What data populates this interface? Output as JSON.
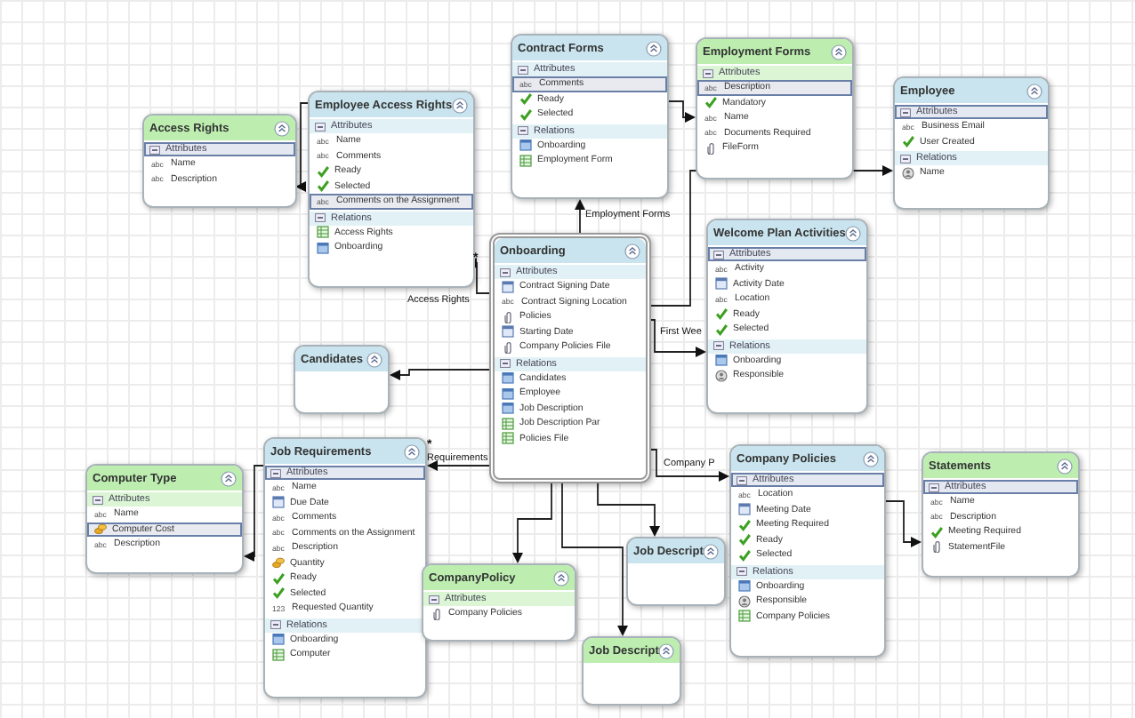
{
  "entities": [
    {
      "title": "Access Rights",
      "color": "#bdeeb0",
      "selected": false,
      "sections": [
        {
          "label": "Attributes",
          "selected": true,
          "items": [
            {
              "kind": "text",
              "type_label": "abc",
              "label": "Name",
              "selected": false
            },
            {
              "kind": "text",
              "type_label": "abc",
              "label": "Description",
              "selected": false
            }
          ]
        }
      ]
    },
    {
      "title": "Employee Access Rights",
      "color": "#c9e4ee",
      "selected": false,
      "sections": [
        {
          "label": "Attributes",
          "selected": false,
          "items": [
            {
              "kind": "text",
              "type_label": "abc",
              "label": "Name",
              "selected": false
            },
            {
              "kind": "text",
              "type_label": "abc",
              "label": "Comments",
              "selected": false
            },
            {
              "kind": "check",
              "label": "Ready",
              "selected": false
            },
            {
              "kind": "check",
              "label": "Selected",
              "selected": false
            },
            {
              "kind": "text",
              "type_label": "abc",
              "label": "Comments on the Assignment",
              "selected": true
            }
          ]
        },
        {
          "label": "Relations",
          "selected": false,
          "items": [
            {
              "kind": "table",
              "label": "Access Rights",
              "selected": false
            },
            {
              "kind": "entity",
              "label": "Onboarding",
              "selected": false
            }
          ]
        }
      ]
    },
    {
      "title": "Contract Forms",
      "color": "#c9e4ee",
      "selected": false,
      "sections": [
        {
          "label": "Attributes",
          "selected": false,
          "items": [
            {
              "kind": "text",
              "type_label": "abc",
              "label": "Comments",
              "selected": true
            },
            {
              "kind": "check",
              "label": "Ready",
              "selected": false
            },
            {
              "kind": "check",
              "label": "Selected",
              "selected": false
            }
          ]
        },
        {
          "label": "Relations",
          "selected": false,
          "items": [
            {
              "kind": "entity",
              "label": "Onboarding",
              "selected": false
            },
            {
              "kind": "table",
              "label": "Employment Form",
              "selected": false
            }
          ]
        }
      ]
    },
    {
      "title": "Employment Forms",
      "color": "#bdeeb0",
      "selected": false,
      "sections": [
        {
          "label": "Attributes",
          "selected": false,
          "items": [
            {
              "kind": "text",
              "type_label": "abc",
              "label": "Description",
              "selected": true
            },
            {
              "kind": "check",
              "label": "Mandatory",
              "selected": false
            },
            {
              "kind": "text",
              "type_label": "abc",
              "label": "Name",
              "selected": false
            },
            {
              "kind": "text",
              "type_label": "abc",
              "label": "Documents Required",
              "selected": false
            },
            {
              "kind": "attachment",
              "label": "FileForm",
              "selected": false
            }
          ]
        }
      ]
    },
    {
      "title": "Employee",
      "color": "#c9e4ee",
      "selected": false,
      "sections": [
        {
          "label": "Attributes",
          "selected": true,
          "items": [
            {
              "kind": "text",
              "type_label": "abc",
              "label": "Business Email",
              "selected": false
            },
            {
              "kind": "check",
              "label": "User Created",
              "selected": false
            }
          ]
        },
        {
          "label": "Relations",
          "selected": false,
          "items": [
            {
              "kind": "user",
              "label": "Name",
              "selected": false
            }
          ]
        }
      ]
    },
    {
      "title": "Onboarding",
      "color": "#c9e4ee",
      "selected": true,
      "sections": [
        {
          "label": "Attributes",
          "selected": false,
          "items": [
            {
              "kind": "date",
              "label": "Contract Signing Date",
              "selected": false
            },
            {
              "kind": "text",
              "type_label": "abc",
              "label": "Contract Signing Location",
              "selected": false
            },
            {
              "kind": "attachment",
              "label": "Policies",
              "selected": false
            },
            {
              "kind": "date",
              "label": "Starting Date",
              "selected": false
            },
            {
              "kind": "attachment",
              "label": "Company Policies File",
              "selected": false
            }
          ]
        },
        {
          "label": "Relations",
          "selected": false,
          "items": [
            {
              "kind": "entity",
              "label": "Candidates",
              "selected": false
            },
            {
              "kind": "entity",
              "label": "Employee",
              "selected": false
            },
            {
              "kind": "entity",
              "label": "Job Description",
              "selected": false
            },
            {
              "kind": "table",
              "label": "Job Description Par",
              "selected": false
            },
            {
              "kind": "table",
              "label": "Policies File",
              "selected": false
            }
          ]
        }
      ]
    },
    {
      "title": "Welcome Plan Activities",
      "color": "#c9e4ee",
      "selected": false,
      "sections": [
        {
          "label": "Attributes",
          "selected": true,
          "items": [
            {
              "kind": "text",
              "type_label": "abc",
              "label": "Activity",
              "selected": false
            },
            {
              "kind": "date",
              "label": "Activity Date",
              "selected": false
            },
            {
              "kind": "text",
              "type_label": "abc",
              "label": "Location",
              "selected": false
            },
            {
              "kind": "check",
              "label": "Ready",
              "selected": false
            },
            {
              "kind": "check",
              "label": "Selected",
              "selected": false
            }
          ]
        },
        {
          "label": "Relations",
          "selected": false,
          "items": [
            {
              "kind": "entity",
              "label": "Onboarding",
              "selected": false
            },
            {
              "kind": "user",
              "label": "Responsible",
              "selected": false
            }
          ]
        }
      ]
    },
    {
      "title": "Candidates",
      "color": "#c9e4ee",
      "selected": false
    },
    {
      "title": "Job Requirements",
      "color": "#c9e4ee",
      "selected": false,
      "sections": [
        {
          "label": "Attributes",
          "selected": true,
          "items": [
            {
              "kind": "text",
              "type_label": "abc",
              "label": "Name",
              "selected": false
            },
            {
              "kind": "date",
              "label": "Due Date",
              "selected": false
            },
            {
              "kind": "text",
              "type_label": "abc",
              "label": "Comments",
              "selected": false
            },
            {
              "kind": "text",
              "type_label": "abc",
              "label": "Comments on the Assignment",
              "selected": false
            },
            {
              "kind": "text",
              "type_label": "abc",
              "label": "Description",
              "selected": false
            },
            {
              "kind": "money",
              "label": "Quantity",
              "selected": false
            },
            {
              "kind": "check",
              "label": "Ready",
              "selected": false
            },
            {
              "kind": "check",
              "label": "Selected",
              "selected": false
            },
            {
              "kind": "number",
              "type_label": "123",
              "label": "Requested Quantity",
              "selected": false
            }
          ]
        },
        {
          "label": "Relations",
          "selected": false,
          "items": [
            {
              "kind": "entity",
              "label": "Onboarding",
              "selected": false
            },
            {
              "kind": "table",
              "label": "Computer",
              "selected": false
            }
          ]
        }
      ]
    },
    {
      "title": "Computer Type",
      "color": "#bdeeb0",
      "selected": false,
      "sections": [
        {
          "label": "Attributes",
          "selected": false,
          "items": [
            {
              "kind": "text",
              "type_label": "abc",
              "label": "Name",
              "selected": false
            },
            {
              "kind": "money",
              "label": "Computer Cost",
              "selected": true
            },
            {
              "kind": "text",
              "type_label": "abc",
              "label": "Description",
              "selected": false
            }
          ]
        }
      ]
    },
    {
      "title": "CompanyPolicy",
      "color": "#bdeeb0",
      "selected": false,
      "sections": [
        {
          "label": "Attributes",
          "selected": false,
          "items": [
            {
              "kind": "attachment",
              "label": "Company Policies",
              "selected": false
            }
          ]
        }
      ]
    },
    {
      "title": "Job Descript",
      "color": "#c9e4ee",
      "selected": false
    },
    {
      "title": "Job Descript",
      "color": "#bdeeb0",
      "selected": false
    },
    {
      "title": "Company Policies",
      "color": "#c9e4ee",
      "selected": false,
      "sections": [
        {
          "label": "Attributes",
          "selected": true,
          "items": [
            {
              "kind": "text",
              "type_label": "abc",
              "label": "Location",
              "selected": false
            },
            {
              "kind": "date",
              "label": "Meeting Date",
              "selected": false
            },
            {
              "kind": "check",
              "label": "Meeting Required",
              "selected": false
            },
            {
              "kind": "check",
              "label": "Ready",
              "selected": false
            },
            {
              "kind": "check",
              "label": "Selected",
              "selected": false
            }
          ]
        },
        {
          "label": "Relations",
          "selected": false,
          "items": [
            {
              "kind": "entity",
              "label": "Onboarding",
              "selected": false
            },
            {
              "kind": "user",
              "label": "Responsible",
              "selected": false
            },
            {
              "kind": "table",
              "label": "Company Policies",
              "selected": false
            }
          ]
        }
      ]
    },
    {
      "title": "Statements",
      "color": "#bdeeb0",
      "selected": false,
      "sections": [
        {
          "label": "Attributes",
          "selected": true,
          "items": [
            {
              "kind": "text",
              "type_label": "abc",
              "label": "Name",
              "selected": false
            },
            {
              "kind": "text",
              "type_label": "abc",
              "label": "Description",
              "selected": false
            },
            {
              "kind": "check",
              "label": "Meeting Required",
              "selected": false
            },
            {
              "kind": "attachment",
              "label": "StatementFile",
              "selected": false
            }
          ]
        }
      ]
    }
  ],
  "connector_labels": [
    {
      "text": "Access Rights",
      "multiplicity": "*"
    },
    {
      "text": "Employment Forms"
    },
    {
      "text": "First Wee"
    },
    {
      "text": "Requirements",
      "multiplicity": "*"
    },
    {
      "text": "Company P"
    }
  ]
}
